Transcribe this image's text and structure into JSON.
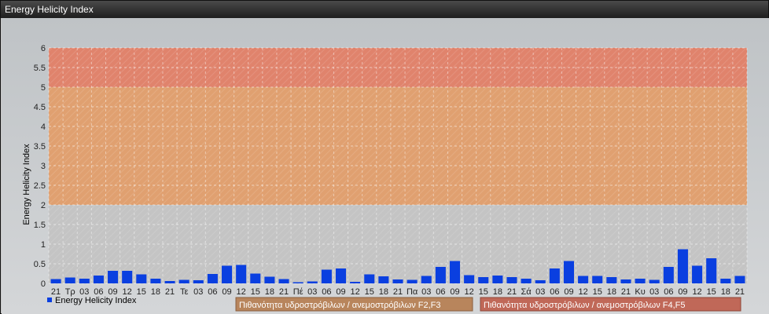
{
  "window": {
    "title": "Energy Helicity Index"
  },
  "colors": {
    "bar": "#0a3fe0",
    "band_f4f5": "#e0836c",
    "band_f2f3": "#e0a070",
    "band_low": "#c4c4c4",
    "legend_f2f3": "#b8855c",
    "legend_f4f5": "#c06858"
  },
  "legend": {
    "series_label": "Energy Helicity Index",
    "band_f2f3": "Πιθανότητα υδροστρόβιλων / ανεμοστρόβιλων F2,F3",
    "band_f4f5": "Πιθανότητα υδροστρόβιλων / ανεμοστρόβιλων F4,F5"
  },
  "chart_data": {
    "type": "bar",
    "ylabel": "Energy Helicity Index",
    "xlabel": "",
    "ylim": [
      0,
      6
    ],
    "yticks": [
      "0",
      "0.5",
      "1",
      "1.5",
      "2",
      "2.5",
      "3",
      "3.5",
      "4",
      "4.5",
      "5",
      "5.5",
      "6"
    ],
    "grid": true,
    "legend_position": "bottom-left",
    "bands": [
      {
        "from": 2,
        "to": 5,
        "name": "F2,F3"
      },
      {
        "from": 5,
        "to": 6,
        "name": "F4,F5"
      }
    ],
    "categories": [
      "21",
      "Τρ",
      "03",
      "06",
      "09",
      "12",
      "15",
      "18",
      "21",
      "Τε",
      "03",
      "06",
      "09",
      "12",
      "15",
      "18",
      "21",
      "Πέ",
      "03",
      "06",
      "09",
      "12",
      "15",
      "18",
      "21",
      "Πα",
      "03",
      "06",
      "09",
      "12",
      "15",
      "18",
      "21",
      "Σά",
      "03",
      "06",
      "09",
      "12",
      "15",
      "18",
      "21",
      "Κυ",
      "03",
      "06",
      "09",
      "12",
      "15",
      "18",
      "21"
    ],
    "series": [
      {
        "name": "Energy Helicity Index",
        "values": [
          0.11,
          0.15,
          0.12,
          0.2,
          0.32,
          0.32,
          0.23,
          0.12,
          0.06,
          0.09,
          0.08,
          0.24,
          0.45,
          0.47,
          0.25,
          0.17,
          0.11,
          0.03,
          0.05,
          0.35,
          0.38,
          0.04,
          0.23,
          0.18,
          0.1,
          0.09,
          0.19,
          0.42,
          0.57,
          0.21,
          0.16,
          0.2,
          0.16,
          0.12,
          0.08,
          0.38,
          0.57,
          0.19,
          0.19,
          0.16,
          0.1,
          0.12,
          0.09,
          0.42,
          0.87,
          0.45,
          0.64,
          0.12,
          0.19
        ]
      }
    ]
  }
}
